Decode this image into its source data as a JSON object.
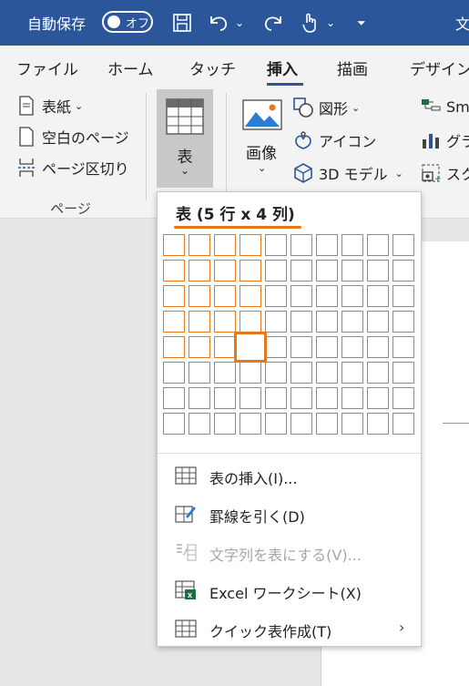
{
  "titlebar": {
    "autosave_label": "自動保存",
    "toggle_state": "オフ",
    "title_partial": "文"
  },
  "tabs": [
    {
      "label": "ファイル"
    },
    {
      "label": "ホーム"
    },
    {
      "label": "タッチ"
    },
    {
      "label": "挿入",
      "active": true
    },
    {
      "label": "描画"
    },
    {
      "label": "デザイン"
    }
  ],
  "ribbon": {
    "pages_group": {
      "cover": "表紙",
      "blank": "空白のページ",
      "page_break": "ページ区切り",
      "group_label": "ページ"
    },
    "table_button": "表",
    "picture_button": "画像",
    "shapes": "図形",
    "icons": "アイコン",
    "model3d": "3D モデル",
    "smartart_partial": "Sm",
    "chart_partial": "グラ",
    "screenshot_partial": "スク"
  },
  "table_menu": {
    "header": "表 (5 行 x 4 列)",
    "selected_rows": 5,
    "selected_cols": 4,
    "grid_rows": 8,
    "grid_cols": 10,
    "items": [
      {
        "label": "表の挿入(I)...",
        "icon": "table-icon",
        "disabled": false
      },
      {
        "label": "罫線を引く(D)",
        "icon": "draw-table-icon",
        "disabled": false
      },
      {
        "label": "文字列を表にする(V)...",
        "icon": "text-to-table-icon",
        "disabled": true
      },
      {
        "label": "Excel ワークシート(X)",
        "icon": "excel-icon",
        "disabled": false
      },
      {
        "label": "クイック表作成(T)",
        "icon": "quick-table-icon",
        "disabled": false,
        "submenu": true
      }
    ]
  },
  "colors": {
    "title_bar": "#2b579a",
    "selection": "#e8761b",
    "excel_green": "#1d6f42"
  }
}
